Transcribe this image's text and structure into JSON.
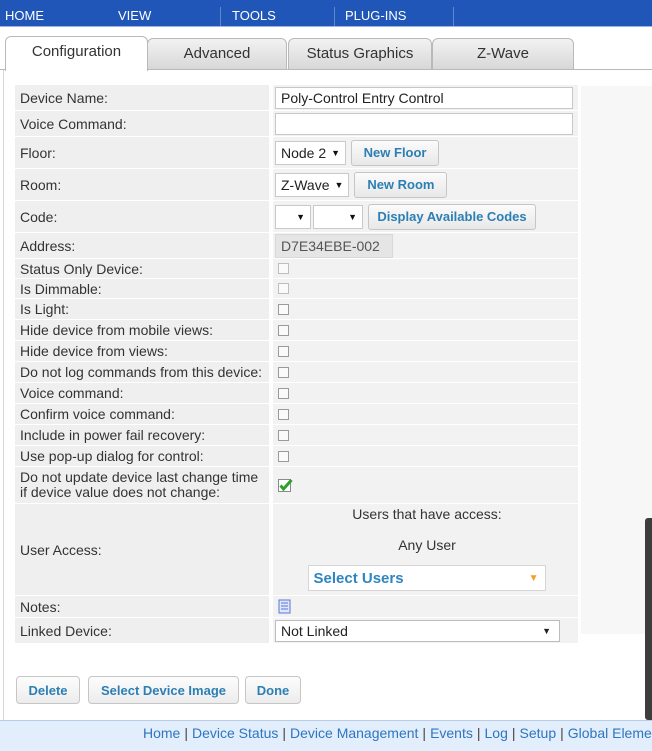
{
  "menu": [
    "HOME",
    "VIEW",
    "TOOLS",
    "PLUG-INS"
  ],
  "tabs": [
    "Configuration",
    "Advanced",
    "Status Graphics",
    "Z-Wave"
  ],
  "form": {
    "device_name": {
      "label": "Device Name:",
      "value": "Poly-Control Entry Control"
    },
    "voice_command": {
      "label": "Voice Command:",
      "value": ""
    },
    "floor": {
      "label": "Floor:",
      "selected": "Node 2",
      "button": "New Floor"
    },
    "room": {
      "label": "Room:",
      "selected": "Z-Wave",
      "button": "New Room"
    },
    "code": {
      "label": "Code:",
      "selected_1": "",
      "selected_2": "",
      "button": "Display Available Codes"
    },
    "address": {
      "label": "Address:",
      "value": "D7E34EBE-002"
    },
    "checkboxes": [
      {
        "label": "Status Only Device:",
        "checked": false,
        "disabled": true
      },
      {
        "label": "Is Dimmable:",
        "checked": false,
        "disabled": true
      },
      {
        "label": "Is Light:",
        "checked": false,
        "disabled": false
      },
      {
        "label": "Hide device from mobile views:",
        "checked": false,
        "disabled": false
      },
      {
        "label": "Hide device from views:",
        "checked": false,
        "disabled": false
      },
      {
        "label": "Do not log commands from this device:",
        "checked": false,
        "disabled": false
      },
      {
        "label": "Voice command:",
        "checked": false,
        "disabled": false
      },
      {
        "label": "Confirm voice command:",
        "checked": false,
        "disabled": false
      },
      {
        "label": "Include in power fail recovery:",
        "checked": false,
        "disabled": false
      },
      {
        "label": "Use pop-up dialog for control:",
        "checked": false,
        "disabled": false
      }
    ],
    "no_update": {
      "label_line1": "Do not update device last change time",
      "label_line2": "if device value does not change:",
      "checked": true
    },
    "user_access": {
      "label": "User Access:",
      "heading": "Users that have access:",
      "users": "Any User",
      "select_label": "Select Users"
    },
    "notes": {
      "label": "Notes:"
    },
    "linked_device": {
      "label": "Linked Device:",
      "selected": "Not Linked"
    }
  },
  "buttons": {
    "delete": "Delete",
    "select_image": "Select Device Image",
    "done": "Done"
  },
  "footer": [
    "Home",
    "Device Status",
    "Device Management",
    "Events",
    "Log",
    "Setup",
    "Global Elements"
  ],
  "colors": {
    "menubar": "#1f56b8",
    "accent_link": "#2c7fb4",
    "check": "#2aa12a",
    "select_arrow": "#f4a020"
  }
}
